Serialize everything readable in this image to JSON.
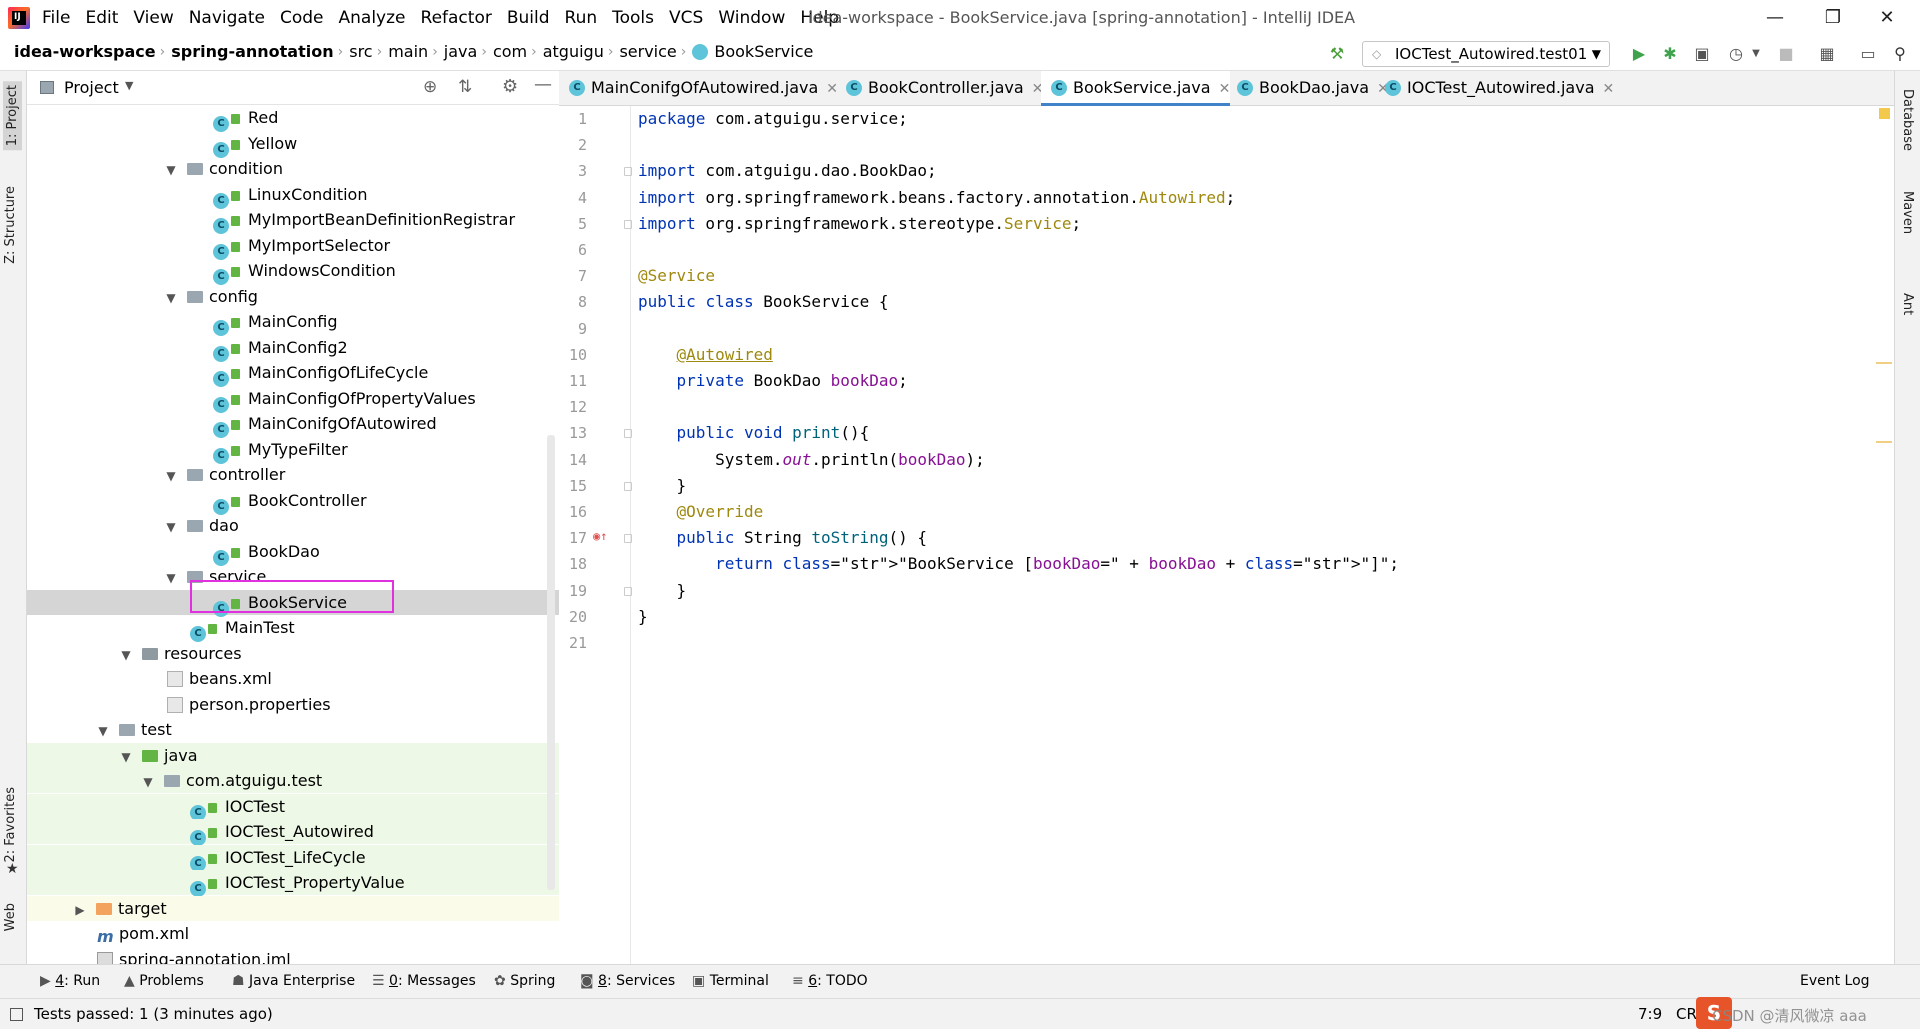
{
  "window": {
    "title": "idea-workspace - BookService.java [spring-annotation] - IntelliJ IDEA",
    "app_icon_text": "IJ"
  },
  "menu": [
    "File",
    "Edit",
    "View",
    "Navigate",
    "Code",
    "Analyze",
    "Refactor",
    "Build",
    "Run",
    "Tools",
    "VCS",
    "Window",
    "Help"
  ],
  "breadcrumbs": [
    "idea-workspace",
    "spring-annotation",
    "src",
    "main",
    "java",
    "com",
    "atguigu",
    "service",
    "BookService"
  ],
  "toolbar": {
    "run_config": "IOCTest_Autowired.test01"
  },
  "left_strip": {
    "project_tab": "1: Project",
    "structure_tab": "Z: Structure",
    "favorites_tab": "2: Favorites",
    "web_tab": "Web"
  },
  "right_strip": {
    "database_tab": "Database",
    "maven_tab": "Maven",
    "ant_tab": "Ant"
  },
  "project_panel": {
    "title": "Project",
    "tree": [
      {
        "label": "Red",
        "kind": "class",
        "indent": 3
      },
      {
        "label": "Yellow",
        "kind": "class",
        "indent": 3
      },
      {
        "label": "condition",
        "kind": "package",
        "indent": 2,
        "expanded": true
      },
      {
        "label": "LinuxCondition",
        "kind": "class",
        "indent": 3
      },
      {
        "label": "MyImportBeanDefinitionRegistrar",
        "kind": "class",
        "indent": 3
      },
      {
        "label": "MyImportSelector",
        "kind": "class",
        "indent": 3
      },
      {
        "label": "WindowsCondition",
        "kind": "class",
        "indent": 3
      },
      {
        "label": "config",
        "kind": "package",
        "indent": 2,
        "expanded": true
      },
      {
        "label": "MainConfig",
        "kind": "class",
        "indent": 3
      },
      {
        "label": "MainConfig2",
        "kind": "class",
        "indent": 3
      },
      {
        "label": "MainConfigOfLifeCycle",
        "kind": "class",
        "indent": 3
      },
      {
        "label": "MainConfigOfPropertyValues",
        "kind": "class",
        "indent": 3
      },
      {
        "label": "MainConifgOfAutowired",
        "kind": "class",
        "indent": 3
      },
      {
        "label": "MyTypeFilter",
        "kind": "class",
        "indent": 3
      },
      {
        "label": "controller",
        "kind": "package",
        "indent": 2,
        "expanded": true
      },
      {
        "label": "BookController",
        "kind": "class",
        "indent": 3
      },
      {
        "label": "dao",
        "kind": "package",
        "indent": 2,
        "expanded": true
      },
      {
        "label": "BookDao",
        "kind": "class",
        "indent": 3
      },
      {
        "label": "service",
        "kind": "package",
        "indent": 2,
        "expanded": true
      },
      {
        "label": "BookService",
        "kind": "class",
        "indent": 3,
        "selected": true
      },
      {
        "label": "MainTest",
        "kind": "class",
        "indent": 2
      },
      {
        "label": "resources",
        "kind": "resfolder",
        "indent": 1,
        "expanded": true
      },
      {
        "label": "beans.xml",
        "kind": "xml",
        "indent": 2
      },
      {
        "label": "person.properties",
        "kind": "prop",
        "indent": 2
      },
      {
        "label": "test",
        "kind": "folder",
        "indent": 0,
        "expanded": true
      },
      {
        "label": "java",
        "kind": "testfolder",
        "indent": 1,
        "expanded": true,
        "green": true
      },
      {
        "label": "com.atguigu.test",
        "kind": "package",
        "indent": 2,
        "expanded": true,
        "green": true
      },
      {
        "label": "IOCTest",
        "kind": "class",
        "indent": 3,
        "green": true
      },
      {
        "label": "IOCTest_Autowired",
        "kind": "class",
        "indent": 3,
        "green": true
      },
      {
        "label": "IOCTest_LifeCycle",
        "kind": "class",
        "indent": 3,
        "green": true
      },
      {
        "label": "IOCTest_PropertyValue",
        "kind": "class",
        "indent": 3,
        "green": true
      },
      {
        "label": "target",
        "kind": "excluded",
        "indent": -1,
        "collapsed": true,
        "yellow": true
      },
      {
        "label": "pom.xml",
        "kind": "maven",
        "indent": -1
      },
      {
        "label": "spring-annotation.iml",
        "kind": "iml",
        "indent": -1
      }
    ]
  },
  "editor_tabs": [
    {
      "label": "MainConifgOfAutowired.java",
      "active": false
    },
    {
      "label": "BookController.java",
      "active": false
    },
    {
      "label": "BookService.java",
      "active": true
    },
    {
      "label": "BookDao.java",
      "active": false
    },
    {
      "label": "IOCTest_Autowired.java",
      "active": false
    }
  ],
  "code_lines": [
    "package com.atguigu.service;",
    "",
    "import com.atguigu.dao.BookDao;",
    "import org.springframework.beans.factory.annotation.Autowired;",
    "import org.springframework.stereotype.Service;",
    "",
    "@Service",
    "public class BookService {",
    "",
    "    @Autowired",
    "    private BookDao bookDao;",
    "",
    "    public void print(){",
    "        System.out.println(bookDao);",
    "    }",
    "    @Override",
    "    public String toString() {",
    "        return \"BookService [bookDao=\" + bookDao + \"]\";",
    "    }",
    "}",
    ""
  ],
  "bottom_tools": [
    {
      "num": "4",
      "label": ": Run",
      "icon": "run-icon"
    },
    {
      "num": "",
      "label": "Problems",
      "icon": "problems-icon"
    },
    {
      "num": "",
      "label": "Java Enterprise",
      "icon": "java-enterprise-icon"
    },
    {
      "num": "0",
      "label": ": Messages",
      "icon": "messages-icon"
    },
    {
      "num": "",
      "label": "Spring",
      "icon": "spring-icon"
    },
    {
      "num": "8",
      "label": ": Services",
      "icon": "services-icon"
    },
    {
      "num": "",
      "label": "Terminal",
      "icon": "terminal-icon"
    },
    {
      "num": "6",
      "label": ": TODO",
      "icon": "todo-icon"
    }
  ],
  "event_log": "Event Log",
  "status": {
    "message": "Tests passed: 1 (3 minutes ago)",
    "position": "7:9",
    "line_sep": "CRLF",
    "watermark": "CSDN @清风微凉 aaa"
  },
  "colors": {
    "selection_box": "#e030e0",
    "active_tab_underline": "#4083c9",
    "keyword": "#0033b3",
    "annotation": "#9e880d",
    "field": "#871094",
    "string": "#067d17"
  }
}
